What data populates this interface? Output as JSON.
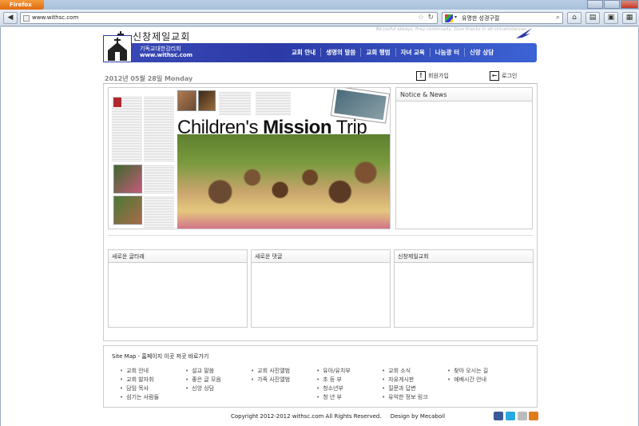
{
  "browser": {
    "app_button": "Firefox",
    "url": "www.withsc.com",
    "search_text": "유명한 성경구절"
  },
  "header": {
    "site_title": "신창제일교회",
    "slogan": "Be joyful always, Pray continually, Give thanks in all circumstances.",
    "denomination": "기독교대한감리회",
    "domain": "www.withsc.com",
    "menu": [
      "교회 안내",
      "생명의 말씀",
      "교회 행범",
      "자녀 교육",
      "나눔광 터",
      "신앙 상담"
    ]
  },
  "toolbar": {
    "date": "2012년 05월 28일 Monday",
    "join_label": "회원가입",
    "login_label": "로그인"
  },
  "main": {
    "magazine_title_light": "Children's ",
    "magazine_title_bold": "Mission",
    "magazine_title_end": " Trip",
    "notice_title": "Notice & News"
  },
  "boxes": [
    {
      "title": "새로운 글타래"
    },
    {
      "title": "새로운 댓글"
    },
    {
      "title": "신창제일교회"
    }
  ],
  "sitemap": {
    "title": "Site Map - 홈페이지 이곳 저곳 바로가기",
    "columns": [
      [
        "교회 안내",
        "교회 발자취",
        "담임 목사",
        "섬기는 사람들"
      ],
      [
        "설교 말씀",
        "좋은 글 모음",
        "신앙 상담"
      ],
      [
        "교회 사진앨범",
        "가족 사진앨범"
      ],
      [
        "유아/유치부",
        "초 등 부",
        "청소년부",
        "청 년 부"
      ],
      [
        "교회 소식",
        "자유게시판",
        "질문과 답변",
        "유익한 정보 링크"
      ],
      [
        "찾아 오시는 길",
        "예배시간 안내"
      ]
    ]
  },
  "footer": {
    "copyright": "Copyright 2012-2012 withsc.com All Rights Reserved.",
    "design": "Design by Mecaboil"
  },
  "colors": {
    "banner": "#2b3aa6",
    "firefox_orange": "#e06b12"
  }
}
